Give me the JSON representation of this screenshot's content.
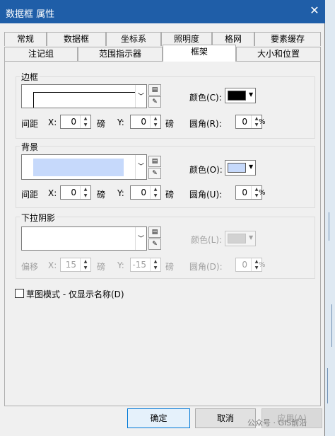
{
  "window": {
    "title": "数据框 属性",
    "close_glyph": "✕"
  },
  "tabs_row1": [
    "常规",
    "数据框",
    "坐标系",
    "照明度",
    "格网",
    "要素缓存"
  ],
  "tabs_row2": [
    "注记组",
    "范围指示器",
    "框架",
    "大小和位置"
  ],
  "border": {
    "label": "边框",
    "color_label": "颜色(C):",
    "color": "#000000",
    "gap_label": "间距",
    "x_label": "X:",
    "x_value": "0",
    "x_unit": "磅",
    "y_label": "Y:",
    "y_value": "0",
    "y_unit": "磅",
    "corner_label": "圆角(R):",
    "corner_value": "0",
    "corner_unit": "%"
  },
  "background": {
    "label": "背景",
    "swatch_color": "#c6d9fb",
    "color_label": "颜色(O):",
    "color": "#c6d9fb",
    "gap_label": "间距",
    "x_label": "X:",
    "x_value": "0",
    "x_unit": "磅",
    "y_label": "Y:",
    "y_value": "0",
    "y_unit": "磅",
    "corner_label": "圆角(U):",
    "corner_value": "0",
    "corner_unit": "%"
  },
  "shadow": {
    "label": "下拉阴影",
    "color_label": "颜色(L):",
    "offset_label": "偏移",
    "x_label": "X:",
    "x_value": "15",
    "x_unit": "磅",
    "y_label": "Y:",
    "y_value": "-15",
    "y_unit": "磅",
    "corner_label": "圆角(D):",
    "corner_value": "0",
    "corner_unit": "%"
  },
  "draft_mode_label": "草图模式 - 仅显示名称(D)",
  "buttons": {
    "ok": "确定",
    "cancel": "取消",
    "apply": "应用(A)"
  },
  "watermark": "公众号 · GIS前沿",
  "colors": {
    "titlebar": "#1f5ea8",
    "dialog_bg": "#f0f0f0",
    "accent": "#0078d7"
  }
}
